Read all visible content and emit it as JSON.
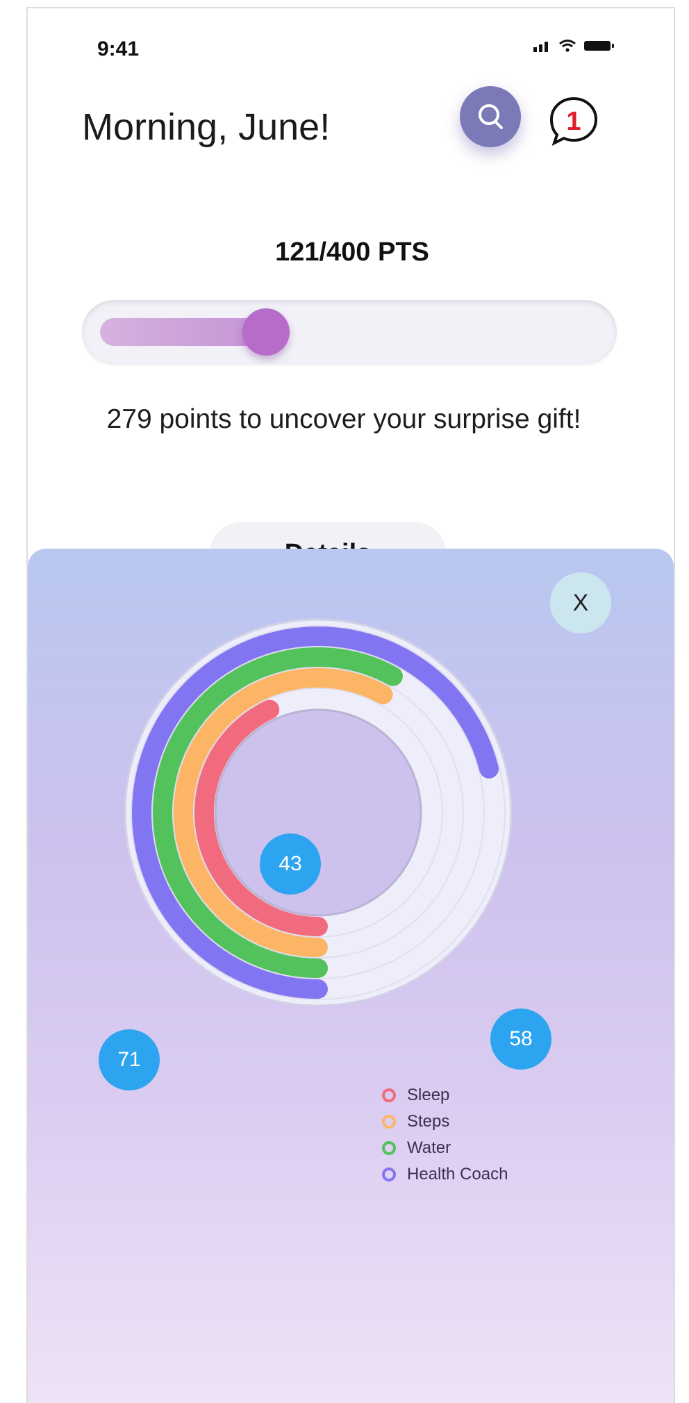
{
  "status_bar": {
    "time": "9:41"
  },
  "header": {
    "greeting": "Morning, June!",
    "notification_count": "1"
  },
  "points": {
    "label": "121/400 PTS",
    "current": 121,
    "total": 400,
    "progress_fraction": 0.3025,
    "message": "279 points to uncover your surprise gift!",
    "details_label": "Details"
  },
  "sheet": {
    "close_label": "X"
  },
  "chart_data": {
    "type": "radial-bar",
    "series": [
      {
        "name": "Sleep",
        "value": 43,
        "color": "#f26a7e"
      },
      {
        "name": "Steps",
        "value": 58,
        "color": "#fbb565"
      },
      {
        "name": "Water",
        "value": 58,
        "color": "#53c25c"
      },
      {
        "name": "Health Coach",
        "value": 71,
        "color": "#8275f1"
      }
    ],
    "value_labels": [
      "43",
      "58",
      "71"
    ],
    "legend": [
      "Sleep",
      "Steps",
      "Water",
      "Health Coach"
    ]
  }
}
